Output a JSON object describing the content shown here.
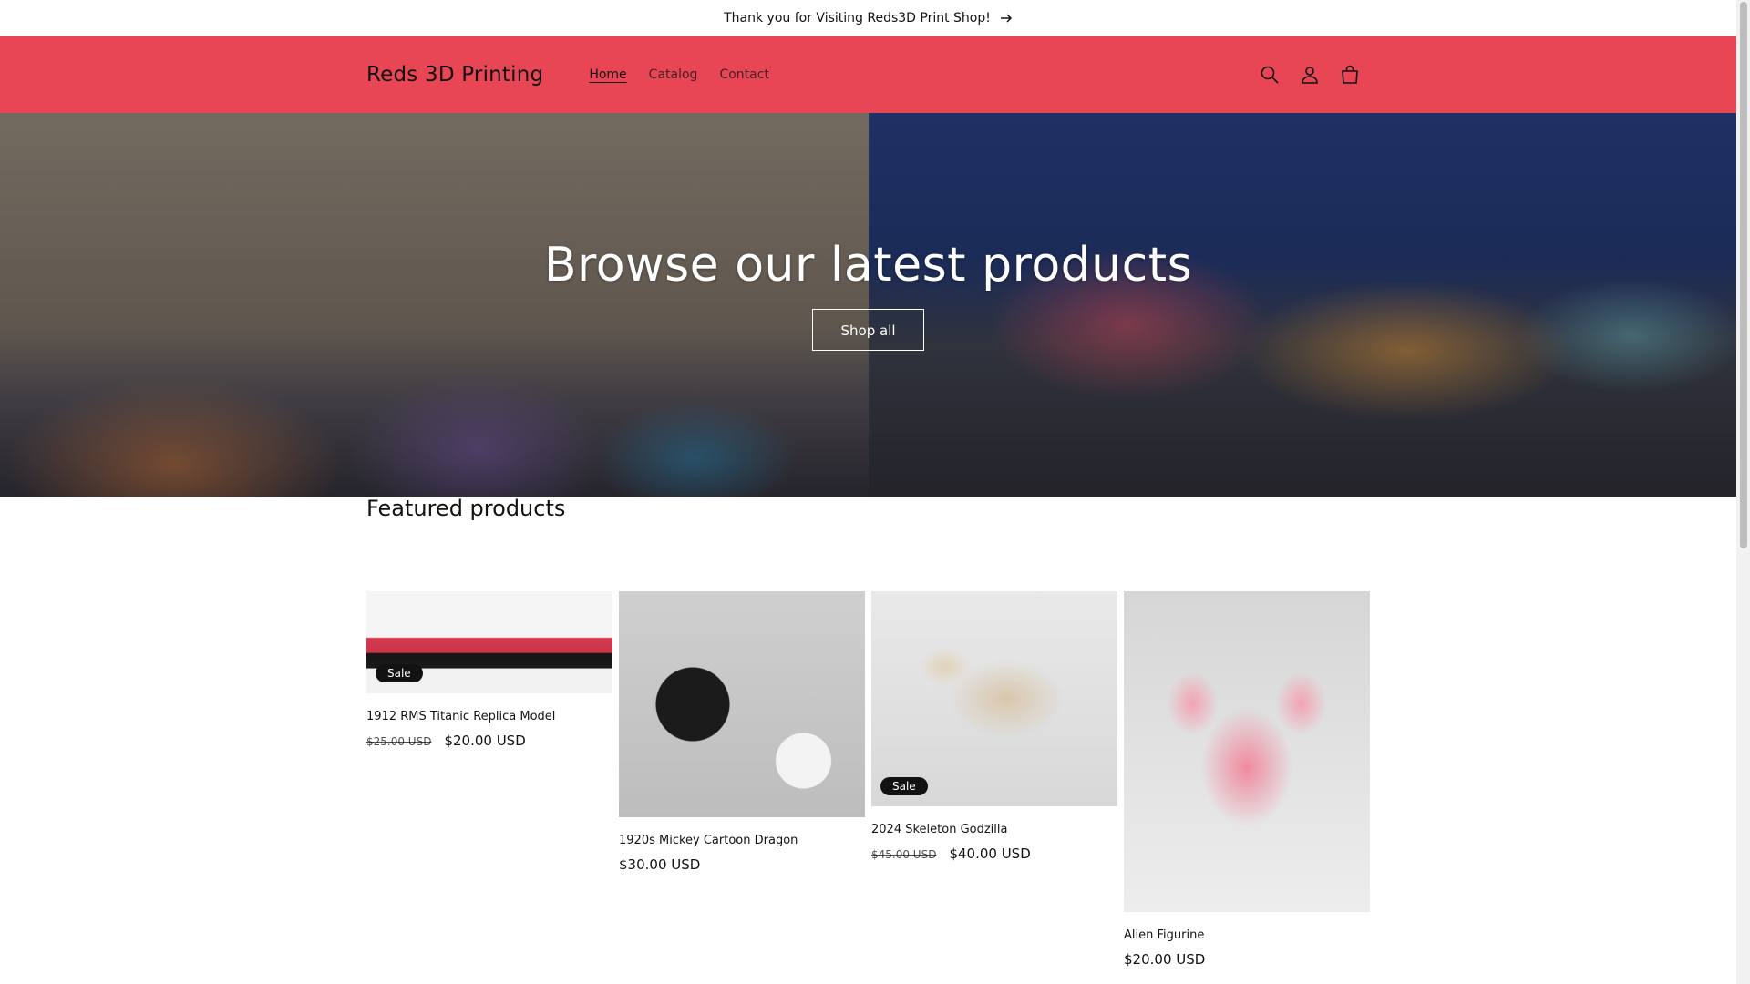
{
  "announcement": {
    "text": "Thank you for Visiting Reds3D Print Shop!"
  },
  "header": {
    "logo": "Reds 3D Printing",
    "nav": [
      {
        "label": "Home"
      },
      {
        "label": "Catalog"
      },
      {
        "label": "Contact"
      }
    ],
    "accent_color": "#e84555"
  },
  "icons": {
    "search": "search-icon",
    "account": "account-icon",
    "cart": "cart-icon",
    "arrow": "arrow-right-icon"
  },
  "hero": {
    "heading": "Browse our latest products",
    "button_label": "Shop all"
  },
  "featured": {
    "heading": "Featured products",
    "products": [
      {
        "title": "1912 RMS Titanic Replica Model",
        "old_price": "$25.00 USD",
        "price": "$20.00 USD",
        "badge": "Sale"
      },
      {
        "title": "1920s Mickey Cartoon Dragon",
        "old_price": "",
        "price": "$30.00 USD",
        "badge": ""
      },
      {
        "title": "2024 Skeleton Godzilla",
        "old_price": "$45.00 USD",
        "price": "$40.00 USD",
        "badge": "Sale"
      },
      {
        "title": "Alien Figurine",
        "old_price": "",
        "price": "$20.00 USD",
        "badge": ""
      }
    ]
  }
}
